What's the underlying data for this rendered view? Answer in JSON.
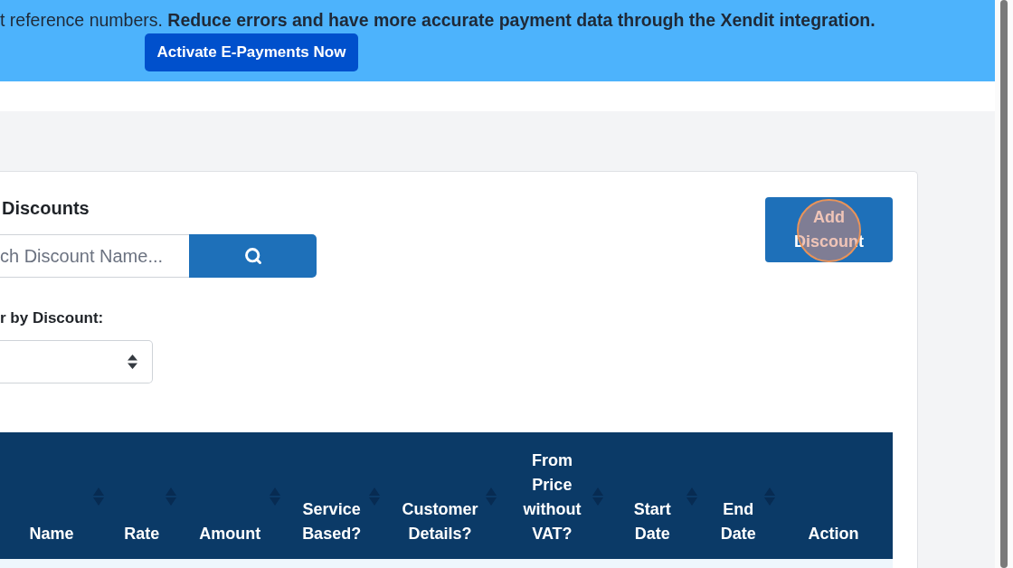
{
  "banner": {
    "text": "t reference numbers. **Reduce errors and have more accurate payment data through the Xendit integration.**",
    "button": "Activate E-Payments Now"
  },
  "page": {
    "title": "Discounts",
    "search": {
      "placeholder": "ch Discount Name..."
    },
    "filter": {
      "label": "r by Discount:"
    },
    "add_button": "Add Discount"
  },
  "table": {
    "columns": [
      {
        "label": "Name",
        "sortable": true
      },
      {
        "label": "Rate",
        "sortable": true
      },
      {
        "label": "Amount",
        "sortable": true
      },
      {
        "label": "Service Based?",
        "sortable": true
      },
      {
        "label": "Customer Details?",
        "sortable": true
      },
      {
        "label": "From Price without VAT?",
        "sortable": true
      },
      {
        "label": "Start Date",
        "sortable": true
      },
      {
        "label": "End Date",
        "sortable": true
      },
      {
        "label": "Action",
        "sortable": false
      }
    ]
  }
}
